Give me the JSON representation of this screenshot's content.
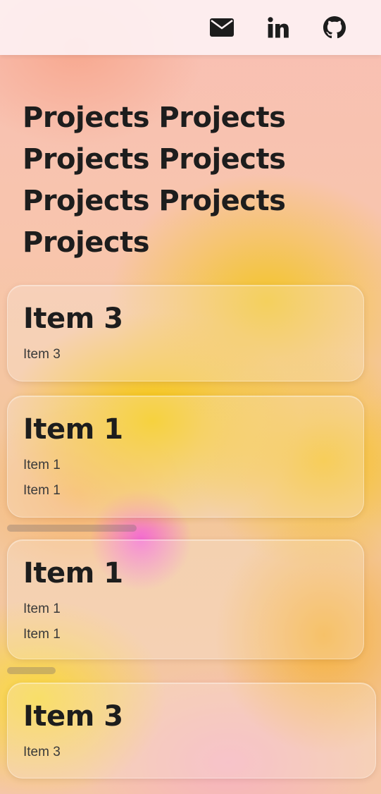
{
  "nav": {
    "icons": [
      "mail-icon",
      "linkedin-icon",
      "github-icon"
    ]
  },
  "page": {
    "title": "Projects Projects Projects Projects Projects Projects Projects"
  },
  "cards": [
    {
      "title": "Item 3",
      "lines": [
        "Item 3"
      ]
    },
    {
      "title": "Item 1",
      "lines": [
        "Item 1",
        "Item 1"
      ]
    },
    {
      "title": "Item 1",
      "lines": [
        "Item 1",
        "Item 1"
      ]
    },
    {
      "title": "Item 3",
      "lines": [
        "Item 3"
      ]
    }
  ],
  "colors": {
    "text": "#1d1d1d",
    "nav_bg": "#fdf1f3",
    "accent_yellow": "#f5c800",
    "accent_pink": "#f46ad2"
  }
}
